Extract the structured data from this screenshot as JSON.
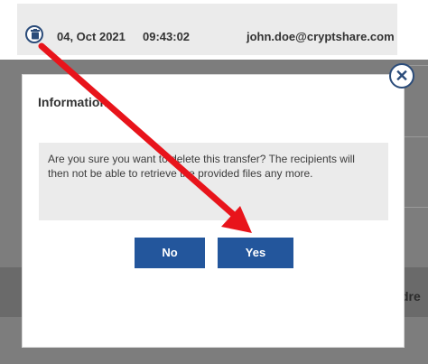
{
  "transfer_row": {
    "date": "04, Oct 2021",
    "time": "09:43:02",
    "email": "john.doe@cryptshare.com",
    "delete_icon": "trash-icon"
  },
  "background": {
    "partial_text": "dre"
  },
  "dialog": {
    "title": "Information",
    "message": "Are you sure you want to delete this transfer? The recipients will then not be able to retrieve the provided files any more.",
    "no_label": "No",
    "yes_label": "Yes",
    "close_icon": "close-icon"
  },
  "annotation": {
    "arrow_color": "#e8141b"
  },
  "colors": {
    "accent": "#23569c",
    "icon_outline": "#2b4c7a"
  }
}
